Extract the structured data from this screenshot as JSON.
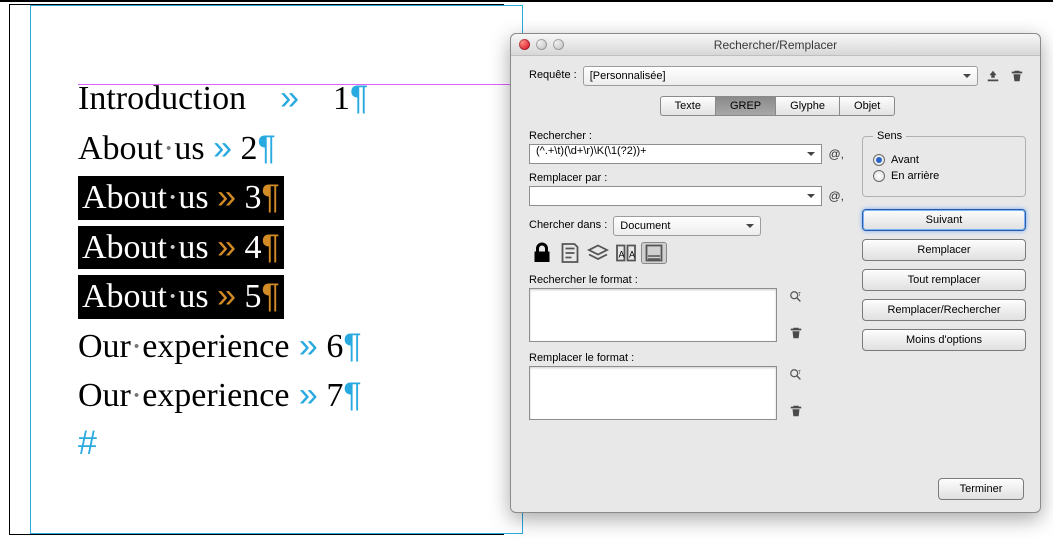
{
  "doc": {
    "lines": [
      {
        "text_a": "Introduction",
        "text_b": "",
        "num": "1",
        "selected": false
      },
      {
        "text_a": "About",
        "text_b": "us",
        "num": "2",
        "selected": false
      },
      {
        "text_a": "About",
        "text_b": "us",
        "num": "3",
        "selected": true
      },
      {
        "text_a": "About",
        "text_b": "us",
        "num": "4",
        "selected": true
      },
      {
        "text_a": "About",
        "text_b": "us",
        "num": "5",
        "selected": true
      },
      {
        "text_a": "Our",
        "text_b": "experience",
        "num": "6",
        "selected": false
      },
      {
        "text_a": "Our",
        "text_b": "experience",
        "num": "7",
        "selected": false
      }
    ],
    "endmark": "#"
  },
  "dialog": {
    "title": "Rechercher/Remplacer",
    "query_label": "Requête :",
    "query_value": "[Personnalisée]",
    "tabs": {
      "t1": "Texte",
      "t2": "GREP",
      "t3": "Glyphe",
      "t4": "Objet"
    },
    "find_label": "Rechercher :",
    "find_value": "(^.+\\t)(\\d+\\r)\\K(\\1(?2))+",
    "replace_label": "Remplacer par :",
    "replace_value": "",
    "searchin_label": "Chercher dans :",
    "searchin_value": "Document",
    "find_format_label": "Rechercher le format :",
    "replace_format_label": "Remplacer le format :",
    "direction": {
      "legend": "Sens",
      "forward": "Avant",
      "backward": "En arrière"
    },
    "buttons": {
      "next": "Suivant",
      "replace": "Remplacer",
      "replace_all": "Tout remplacer",
      "replace_find": "Remplacer/Rechercher",
      "less": "Moins d'options",
      "done": "Terminer"
    }
  }
}
